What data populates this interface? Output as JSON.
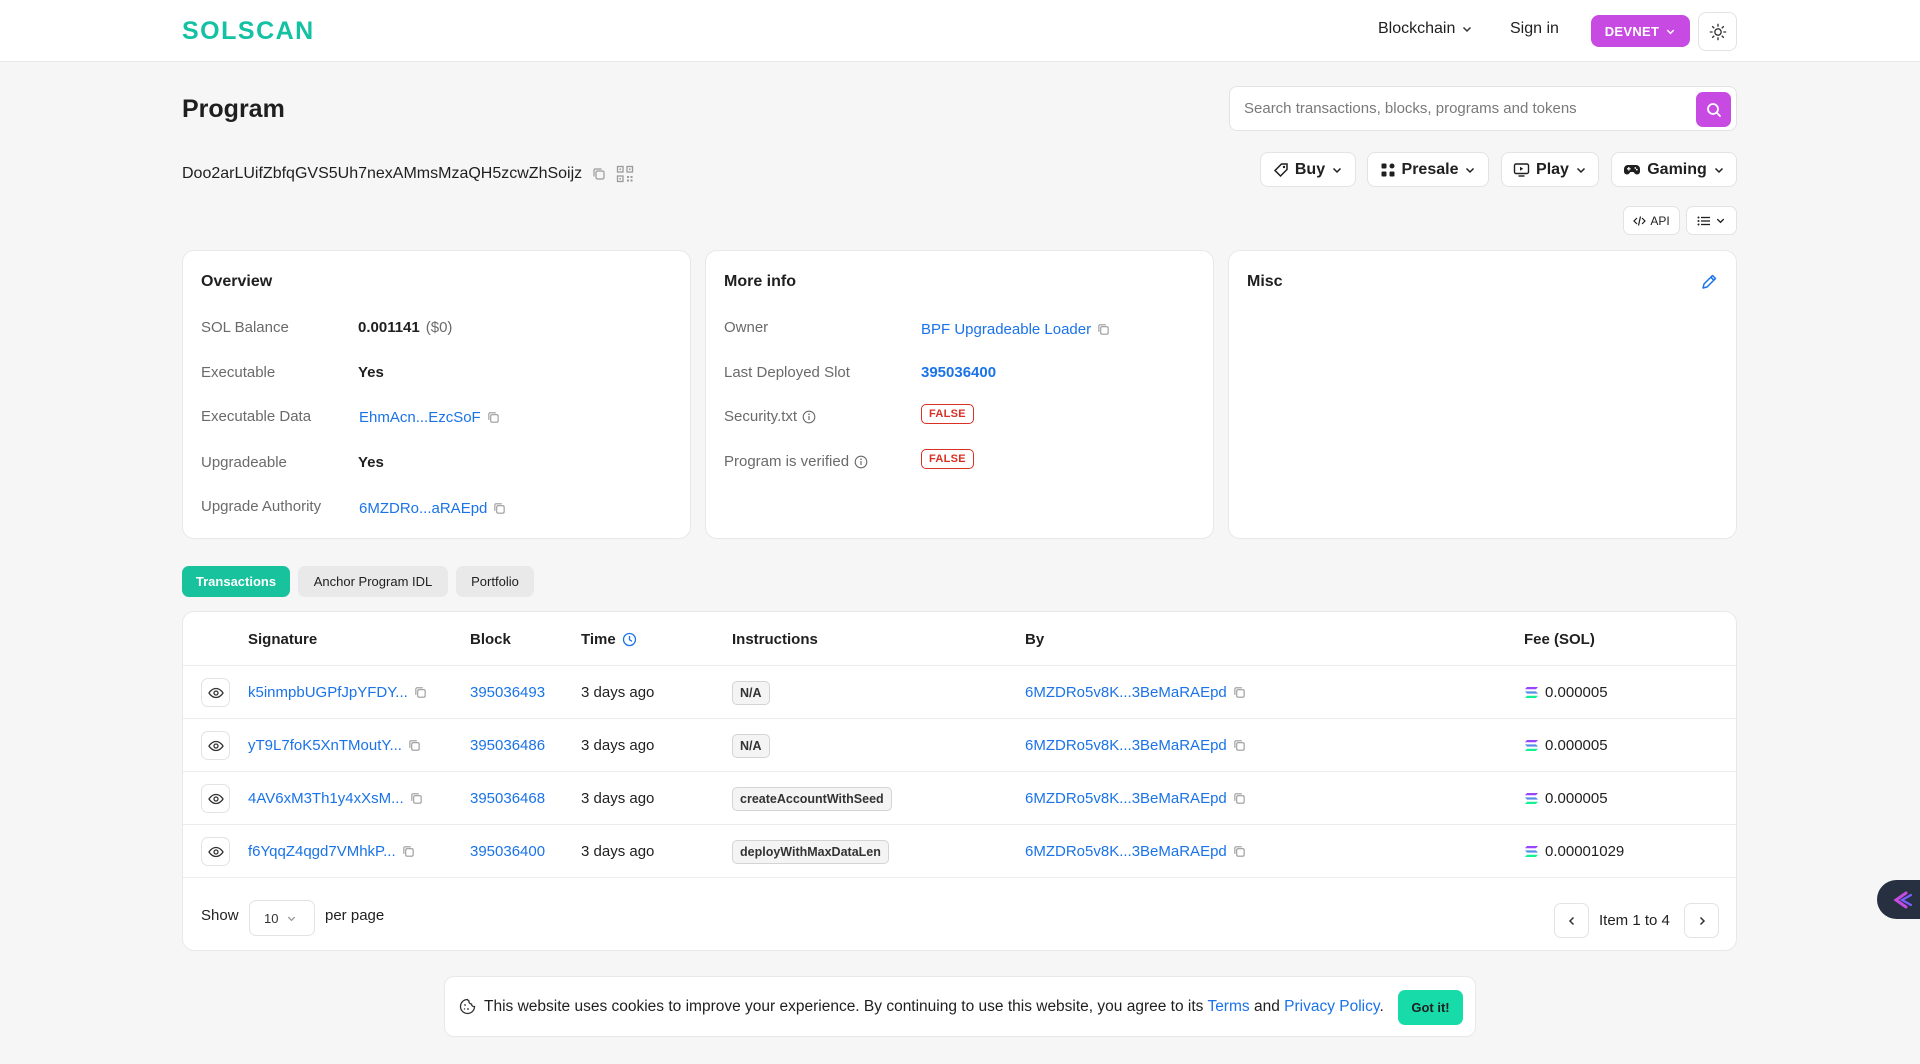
{
  "header": {
    "logo": "SOLSCAN",
    "nav_blockchain": "Blockchain",
    "sign_in": "Sign in",
    "network": "DEVNET"
  },
  "page": {
    "title": "Program",
    "address": "Doo2arLUifZbfqGVS5Uh7nexAMmsMzaQH5zcwZhSoijz"
  },
  "search": {
    "placeholder": "Search transactions, blocks, programs and tokens"
  },
  "actions": {
    "buy": "Buy",
    "presale": "Presale",
    "play": "Play",
    "gaming": "Gaming",
    "api": "API"
  },
  "overview": {
    "title": "Overview",
    "rows": [
      {
        "label": "SOL Balance",
        "value": "0.001141",
        "sub": "($0)"
      },
      {
        "label": "Executable",
        "value": "Yes"
      },
      {
        "label": "Executable Data",
        "value": "EhmAcn...EzcSoF"
      },
      {
        "label": "Upgradeable",
        "value": "Yes"
      },
      {
        "label": "Upgrade Authority",
        "value": "6MZDRo...aRAEpd"
      }
    ]
  },
  "more_info": {
    "title": "More info",
    "rows": [
      {
        "label": "Owner",
        "value": "BPF Upgradeable Loader"
      },
      {
        "label": "Last Deployed Slot",
        "value": "395036400"
      },
      {
        "label": "Security.txt",
        "value": "FALSE"
      },
      {
        "label": "Program is verified",
        "value": "FALSE"
      }
    ]
  },
  "misc": {
    "title": "Misc"
  },
  "tabs": [
    "Transactions",
    "Anchor Program IDL",
    "Portfolio"
  ],
  "table": {
    "columns": [
      "Signature",
      "Block",
      "Time",
      "Instructions",
      "By",
      "Fee (SOL)"
    ],
    "rows": [
      {
        "signature": "k5inmpbUGPfJpYFDY...",
        "block": "395036493",
        "time": "3 days ago",
        "instruction": "N/A",
        "by": "6MZDRo5v8K...3BeMaRAEpd",
        "fee": "0.000005"
      },
      {
        "signature": "yT9L7foK5XnTMoutY...",
        "block": "395036486",
        "time": "3 days ago",
        "instruction": "N/A",
        "by": "6MZDRo5v8K...3BeMaRAEpd",
        "fee": "0.000005"
      },
      {
        "signature": "4AV6xM3Th1y4xXsM...",
        "block": "395036468",
        "time": "3 days ago",
        "instruction": "createAccountWithSeed",
        "by": "6MZDRo5v8K...3BeMaRAEpd",
        "fee": "0.000005"
      },
      {
        "signature": "f6YqqZ4qgd7VMhkP...",
        "block": "395036400",
        "time": "3 days ago",
        "instruction": "deployWithMaxDataLen",
        "by": "6MZDRo5v8K...3BeMaRAEpd",
        "fee": "0.00001029"
      }
    ],
    "show_label": "Show",
    "page_size": "10",
    "per_page_label": "per page",
    "item_range": "Item 1 to 4"
  },
  "cookie": {
    "text": "This website uses cookies to improve your experience. By continuing to use this website, you agree to its",
    "terms": "Terms",
    "and": "and",
    "privacy": "Privacy Policy",
    "period": ".",
    "button": "Got it!"
  },
  "colors": {
    "brand": "#14c1a3",
    "accent_purple": "#c74ae3",
    "link": "#1a73e8",
    "danger": "#d93025",
    "tab_active": "#17c29d"
  }
}
